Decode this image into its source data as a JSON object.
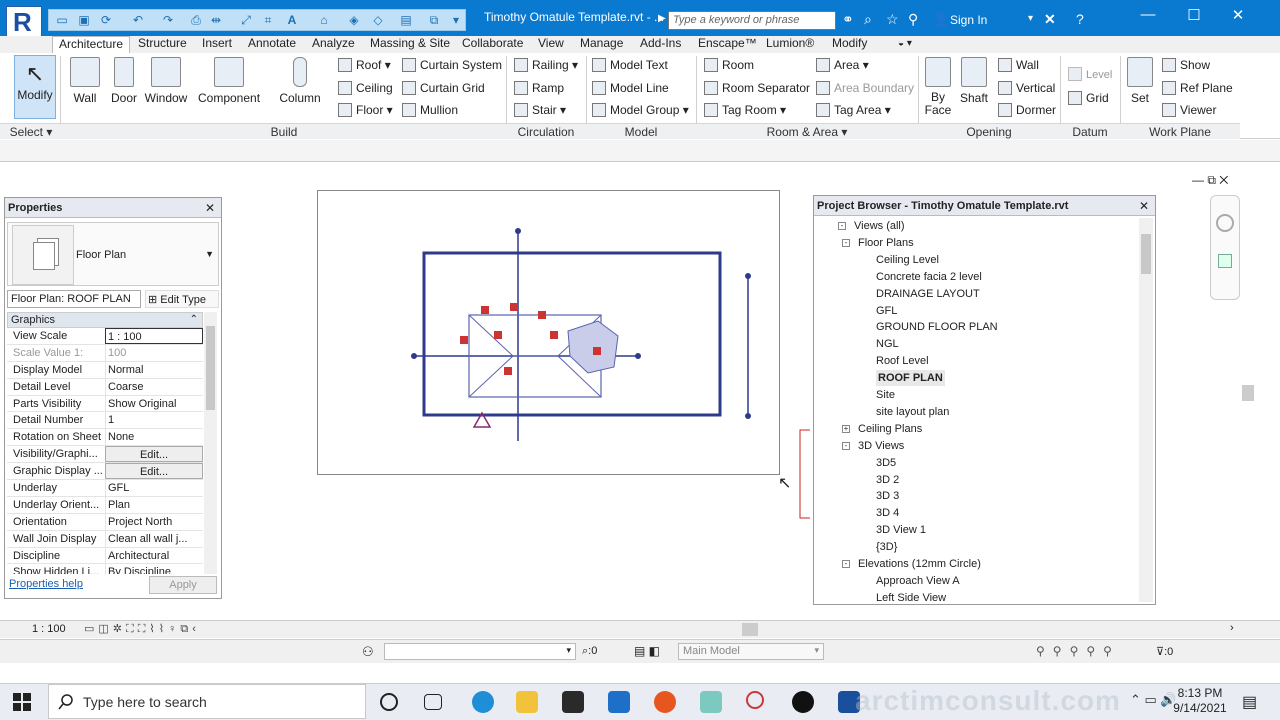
{
  "app": {
    "doc_title": "Timothy Omatule Template.rvt - ...",
    "search_placeholder": "Type a keyword or phrase",
    "sign_in": "Sign In"
  },
  "tabs": [
    "Architecture",
    "Structure",
    "Insert",
    "Annotate",
    "Analyze",
    "Massing & Site",
    "Collaborate",
    "View",
    "Manage",
    "Add-Ins",
    "Enscape™",
    "Lumion®",
    "Modify"
  ],
  "ribbon": {
    "modify": "Modify",
    "build_big": [
      "Wall",
      "Door",
      "Window",
      "Component",
      "Column"
    ],
    "build_small": [
      "Roof",
      "Ceiling",
      "Floor",
      "Curtain System",
      "Curtain Grid",
      "Mullion"
    ],
    "circulation": [
      "Railing",
      "Ramp",
      "Stair"
    ],
    "model": [
      "Model Text",
      "Model Line",
      "Model Group"
    ],
    "room_area": [
      "Room",
      "Room Separator",
      "Tag Room",
      "Area",
      "Area Boundary",
      "Tag Area"
    ],
    "opening_big": [
      "By Face",
      "Shaft"
    ],
    "opening_small": [
      "Wall",
      "Vertical",
      "Dormer"
    ],
    "datum": [
      "Level",
      "Grid"
    ],
    "workplane_big": "Set",
    "workplane_small": [
      "Show",
      "Ref Plane",
      "Viewer"
    ],
    "panels": {
      "select": "Select",
      "build": "Build",
      "circulation": "Circulation",
      "model": "Model",
      "room_area": "Room & Area",
      "opening": "Opening",
      "datum": "Datum",
      "work_plane": "Work Plane"
    }
  },
  "properties": {
    "title": "Properties",
    "type_name": "Floor Plan",
    "instance": "Floor Plan: ROOF PLAN",
    "edit_type": "Edit Type",
    "group": "Graphics",
    "rows": [
      {
        "k": "View Scale",
        "v": "1 : 100",
        "style": "box"
      },
      {
        "k": "Scale Value    1:",
        "v": "100",
        "style": "grey"
      },
      {
        "k": "Display Model",
        "v": "Normal"
      },
      {
        "k": "Detail Level",
        "v": "Coarse"
      },
      {
        "k": "Parts Visibility",
        "v": "Show Original"
      },
      {
        "k": "Detail Number",
        "v": "1"
      },
      {
        "k": "Rotation on Sheet",
        "v": "None"
      },
      {
        "k": "Visibility/Graphi...",
        "v": "Edit...",
        "style": "edit"
      },
      {
        "k": "Graphic Display ...",
        "v": "Edit...",
        "style": "edit"
      },
      {
        "k": "Underlay",
        "v": "GFL"
      },
      {
        "k": "Underlay Orient...",
        "v": "Plan"
      },
      {
        "k": "Orientation",
        "v": "Project North"
      },
      {
        "k": "Wall Join Display",
        "v": "Clean all wall j..."
      },
      {
        "k": "Discipline",
        "v": "Architectural"
      },
      {
        "k": "Show Hidden Li...",
        "v": "By Discipline"
      }
    ],
    "help": "Properties help",
    "apply": "Apply"
  },
  "browser": {
    "title": "Project Browser - Timothy Omatule Template.rvt",
    "nodes": [
      {
        "t": "Views (all)",
        "lvl": 0,
        "ex": "-"
      },
      {
        "t": "Floor Plans",
        "lvl": 1,
        "ex": "-"
      },
      {
        "t": "Ceiling Level",
        "lvl": 2
      },
      {
        "t": "Concrete facia 2 level",
        "lvl": 2
      },
      {
        "t": "DRAINAGE LAYOUT",
        "lvl": 2
      },
      {
        "t": "GFL",
        "lvl": 2
      },
      {
        "t": "GROUND FLOOR PLAN",
        "lvl": 2
      },
      {
        "t": "NGL",
        "lvl": 2
      },
      {
        "t": "Roof Level",
        "lvl": 2
      },
      {
        "t": "ROOF PLAN",
        "lvl": 2,
        "sel": true
      },
      {
        "t": "Site",
        "lvl": 2
      },
      {
        "t": "site layout plan",
        "lvl": 2
      },
      {
        "t": "Ceiling Plans",
        "lvl": 1,
        "ex": "+"
      },
      {
        "t": "3D Views",
        "lvl": 1,
        "ex": "-"
      },
      {
        "t": "3D5",
        "lvl": 2
      },
      {
        "t": "3D 2",
        "lvl": 2
      },
      {
        "t": "3D 3",
        "lvl": 2
      },
      {
        "t": "3D 4",
        "lvl": 2
      },
      {
        "t": "3D View 1",
        "lvl": 2
      },
      {
        "t": "{3D}",
        "lvl": 2
      },
      {
        "t": "Elevations (12mm Circle)",
        "lvl": 1,
        "ex": "-"
      },
      {
        "t": "Approach View A",
        "lvl": 2
      },
      {
        "t": "Left Side View",
        "lvl": 2
      }
    ]
  },
  "view_bar": {
    "scale": "1 : 100"
  },
  "status": {
    "sel_count": ":0",
    "model": "Main Model",
    "filter": ":0"
  },
  "taskbar": {
    "search": "Type here to search",
    "time": "8:13 PM",
    "date": "9/14/2021",
    "watermark": "arctimconsult.com"
  }
}
